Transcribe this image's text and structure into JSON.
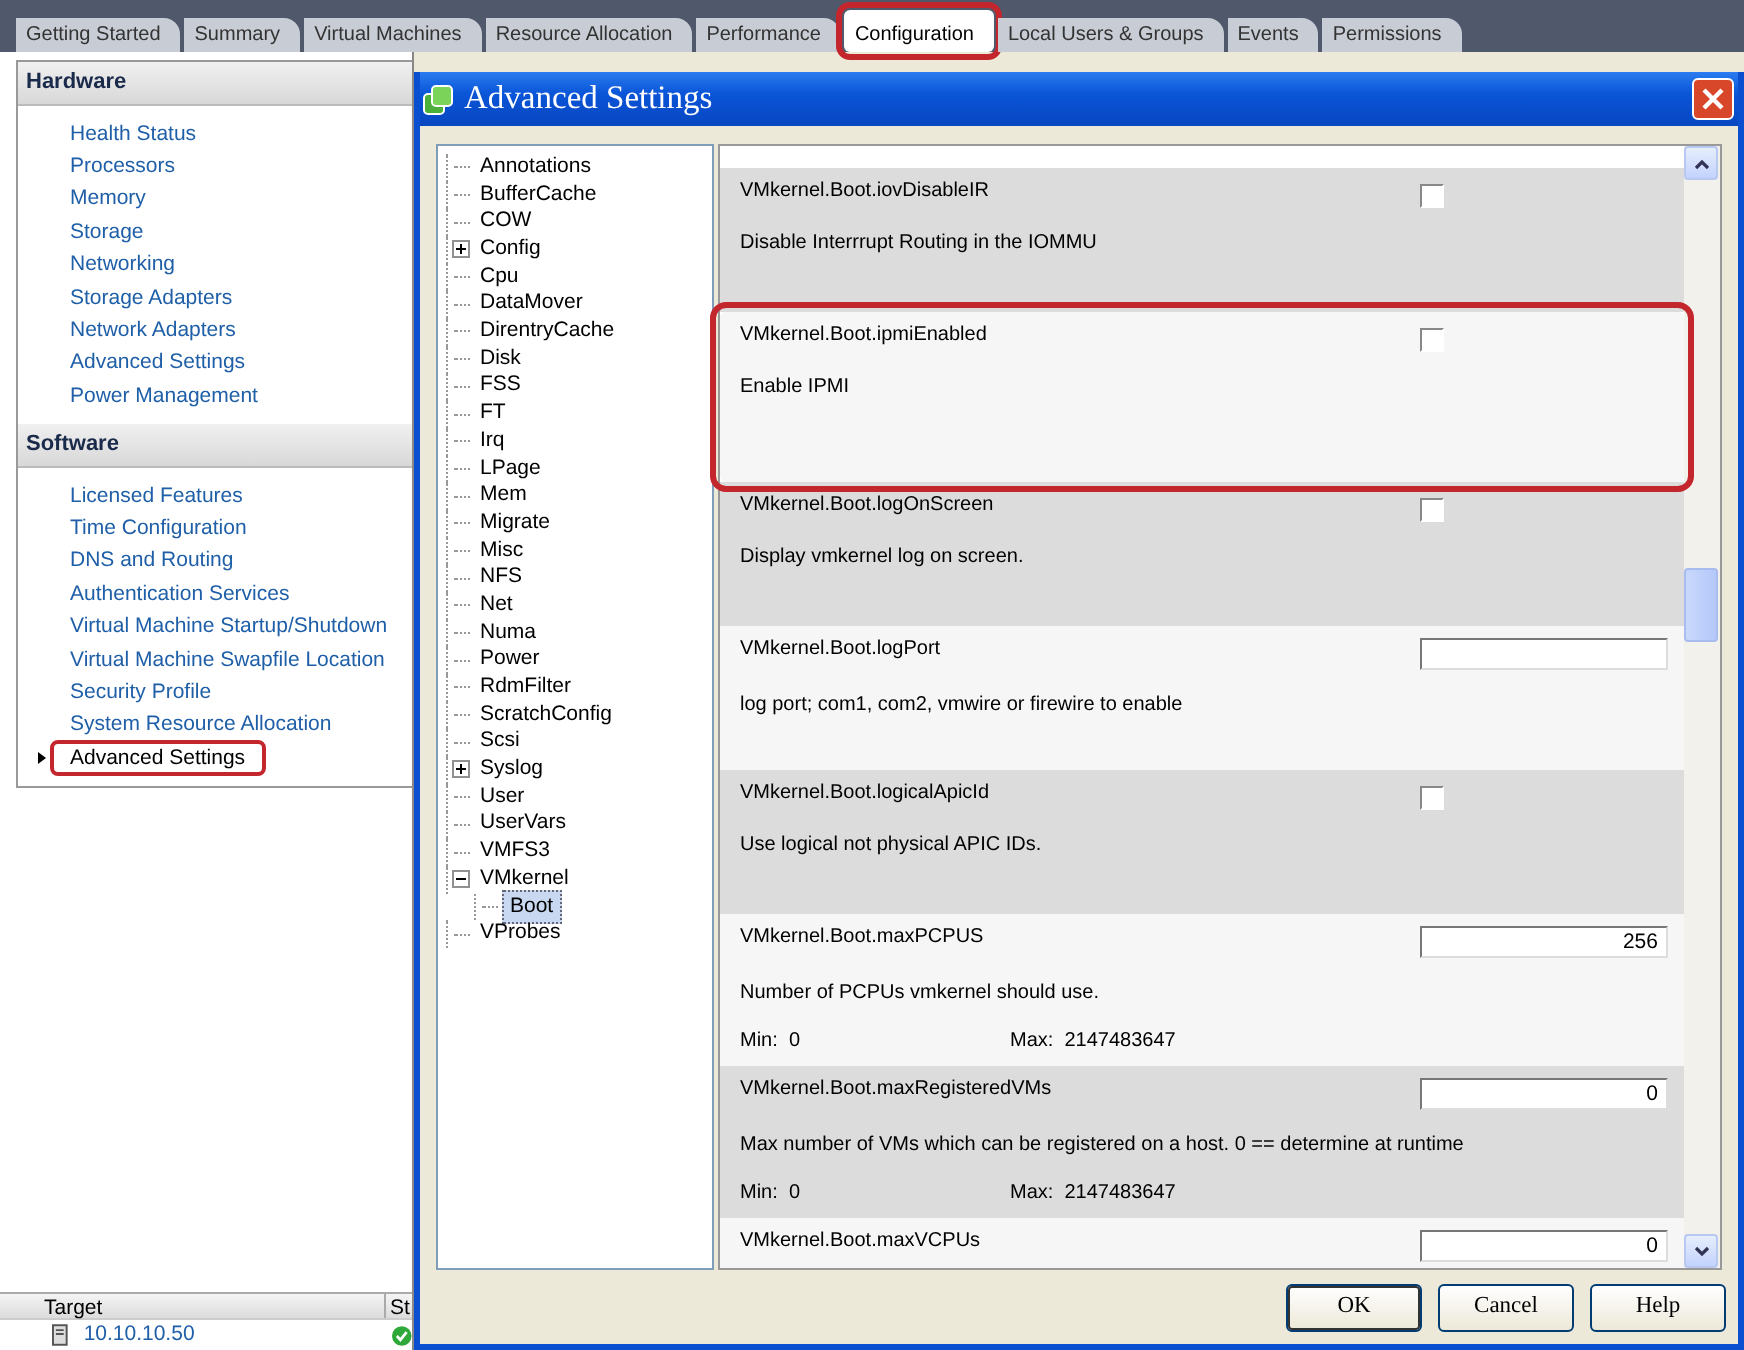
{
  "top_tabs": [
    {
      "label": "Getting Started",
      "selected": false,
      "highlighted": false
    },
    {
      "label": "Summary",
      "selected": false,
      "highlighted": false
    },
    {
      "label": "Virtual Machines",
      "selected": false,
      "highlighted": false
    },
    {
      "label": "Resource Allocation",
      "selected": false,
      "highlighted": false
    },
    {
      "label": "Performance",
      "selected": false,
      "highlighted": false
    },
    {
      "label": "Configuration",
      "selected": true,
      "highlighted": true
    },
    {
      "label": "Local Users & Groups",
      "selected": false,
      "highlighted": false
    },
    {
      "label": "Events",
      "selected": false,
      "highlighted": false
    },
    {
      "label": "Permissions",
      "selected": false,
      "highlighted": false
    }
  ],
  "sidebar": {
    "sections": [
      {
        "title": "Hardware",
        "items": [
          {
            "label": "Health Status",
            "selected": false,
            "highlighted": false
          },
          {
            "label": "Processors",
            "selected": false,
            "highlighted": false
          },
          {
            "label": "Memory",
            "selected": false,
            "highlighted": false
          },
          {
            "label": "Storage",
            "selected": false,
            "highlighted": false
          },
          {
            "label": "Networking",
            "selected": false,
            "highlighted": false
          },
          {
            "label": "Storage Adapters",
            "selected": false,
            "highlighted": false
          },
          {
            "label": "Network Adapters",
            "selected": false,
            "highlighted": false
          },
          {
            "label": "Advanced Settings",
            "selected": false,
            "highlighted": false
          },
          {
            "label": "Power Management",
            "selected": false,
            "highlighted": false
          }
        ]
      },
      {
        "title": "Software",
        "items": [
          {
            "label": "Licensed Features",
            "selected": false,
            "highlighted": false
          },
          {
            "label": "Time Configuration",
            "selected": false,
            "highlighted": false
          },
          {
            "label": "DNS and Routing",
            "selected": false,
            "highlighted": false
          },
          {
            "label": "Authentication Services",
            "selected": false,
            "highlighted": false
          },
          {
            "label": "Virtual Machine Startup/Shutdown",
            "selected": false,
            "highlighted": false
          },
          {
            "label": "Virtual Machine Swapfile Location",
            "selected": false,
            "highlighted": false
          },
          {
            "label": "Security Profile",
            "selected": false,
            "highlighted": false
          },
          {
            "label": "System Resource Allocation",
            "selected": false,
            "highlighted": false
          },
          {
            "label": "Advanced Settings",
            "selected": true,
            "highlighted": true
          }
        ]
      }
    ]
  },
  "recent_tasks": {
    "columns": [
      "Target",
      "St"
    ],
    "rows": [
      {
        "target": "10.10.10.50"
      }
    ]
  },
  "dialog": {
    "title": "Advanced Settings",
    "tree": [
      {
        "label": "Annotations",
        "selected": false
      },
      {
        "label": "BufferCache",
        "selected": false
      },
      {
        "label": "COW",
        "selected": false
      },
      {
        "label": "Config",
        "selected": false,
        "expanded": false
      },
      {
        "label": "Cpu",
        "selected": false
      },
      {
        "label": "DataMover",
        "selected": false
      },
      {
        "label": "DirentryCache",
        "selected": false
      },
      {
        "label": "Disk",
        "selected": false
      },
      {
        "label": "FSS",
        "selected": false
      },
      {
        "label": "FT",
        "selected": false
      },
      {
        "label": "Irq",
        "selected": false
      },
      {
        "label": "LPage",
        "selected": false
      },
      {
        "label": "Mem",
        "selected": false
      },
      {
        "label": "Migrate",
        "selected": false
      },
      {
        "label": "Misc",
        "selected": false
      },
      {
        "label": "NFS",
        "selected": false
      },
      {
        "label": "Net",
        "selected": false
      },
      {
        "label": "Numa",
        "selected": false
      },
      {
        "label": "Power",
        "selected": false
      },
      {
        "label": "RdmFilter",
        "selected": false
      },
      {
        "label": "ScratchConfig",
        "selected": false
      },
      {
        "label": "Scsi",
        "selected": false
      },
      {
        "label": "Syslog",
        "selected": false,
        "expanded": false
      },
      {
        "label": "User",
        "selected": false
      },
      {
        "label": "UserVars",
        "selected": false
      },
      {
        "label": "VMFS3",
        "selected": false
      },
      {
        "label": "VMkernel",
        "selected": false,
        "expanded": true,
        "children": [
          {
            "label": "Boot",
            "selected": true
          }
        ]
      },
      {
        "label": "VProbes",
        "selected": false
      }
    ],
    "settings": [
      {
        "kind": "checkbox",
        "name": "VMkernel.Boot.iovDisableIR",
        "description": "Disable Interrrupt Routing in the IOMMU",
        "checked": false,
        "highlighted": false
      },
      {
        "kind": "checkbox",
        "name": "VMkernel.Boot.ipmiEnabled",
        "description": "Enable IPMI",
        "checked": false,
        "highlighted": true
      },
      {
        "kind": "checkbox",
        "name": "VMkernel.Boot.logOnScreen",
        "description": "Display vmkernel log on screen.",
        "checked": false,
        "highlighted": false
      },
      {
        "kind": "text",
        "name": "VMkernel.Boot.logPort",
        "description": "log port; com1, com2, vmwire or firewire to enable",
        "highlighted": false
      },
      {
        "kind": "checkbox",
        "name": "VMkernel.Boot.logicalApicId",
        "description": "Use logical not physical APIC IDs.",
        "checked": false,
        "highlighted": false
      },
      {
        "kind": "number",
        "name": "VMkernel.Boot.maxPCPUS",
        "description": "Number of PCPUs vmkernel should use.",
        "value": "256",
        "min_label": "Min:",
        "min": "0",
        "max_label": "Max:",
        "max": "2147483647",
        "highlighted": false
      },
      {
        "kind": "number",
        "name": "VMkernel.Boot.maxRegisteredVMs",
        "description": "Max number of VMs which can be registered on a host. 0 == determine at runtime",
        "value": "0",
        "min_label": "Min:",
        "min": "0",
        "max_label": "Max:",
        "max": "2147483647",
        "highlighted": false
      },
      {
        "kind": "number",
        "name": "VMkernel.Boot.maxVCPUs",
        "value": "0",
        "highlighted": false
      }
    ],
    "buttons": [
      {
        "label": "OK",
        "default": true
      },
      {
        "label": "Cancel",
        "default": false
      },
      {
        "label": "Help",
        "default": false
      }
    ]
  }
}
